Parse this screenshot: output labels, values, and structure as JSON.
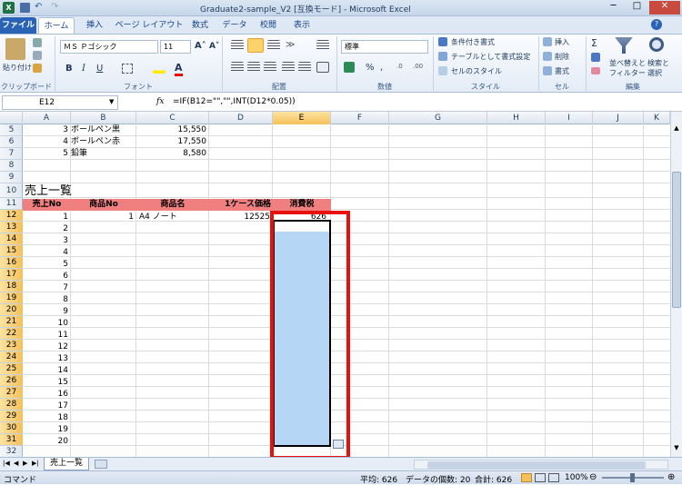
{
  "window": {
    "title": "Graduate2-sample_V2 [互換モード] - Microsoft Excel"
  },
  "tabs": [
    "ファイル",
    "ホーム",
    "挿入",
    "ページ レイアウト",
    "数式",
    "データ",
    "校閲",
    "表示"
  ],
  "ribbon": {
    "clipboard": {
      "paste": "貼り付け",
      "label": "クリップボード"
    },
    "font": {
      "name": "ＭＳ Ｐゴシック",
      "size": "11",
      "label": "フォント"
    },
    "align": {
      "label": "配置"
    },
    "number": {
      "format": "標準",
      "label": "数値"
    },
    "style": {
      "cond": "条件付き書式",
      "table": "テーブルとして書式設定",
      "cell": "セルのスタイル",
      "label": "スタイル"
    },
    "cells": {
      "insert": "挿入",
      "delete": "削除",
      "format": "書式",
      "label": "セル"
    },
    "edit": {
      "sort": "並べ替えと",
      "filter": "フィルター",
      "find": "検索と",
      "select": "選択",
      "label": "編集"
    }
  },
  "formula_bar": {
    "namebox": "E12",
    "fx": "fx",
    "formula": "=IF(B12=\"\",\"\",INT(D12*0.05))"
  },
  "columns": [
    "A",
    "B",
    "C",
    "D",
    "E",
    "F",
    "G",
    "H",
    "I",
    "J",
    "K"
  ],
  "rows": [
    "5",
    "6",
    "7",
    "8",
    "9",
    "10",
    "11",
    "12",
    "13",
    "14",
    "15",
    "16",
    "17",
    "18",
    "19",
    "20",
    "21",
    "22",
    "23",
    "24",
    "25",
    "26",
    "27",
    "28",
    "29",
    "30",
    "31",
    "32"
  ],
  "top_rows": [
    {
      "a": "3",
      "b": "ボールペン黒",
      "c": "15,550"
    },
    {
      "a": "4",
      "b": "ボールペン赤",
      "c": "17,550"
    },
    {
      "a": "5",
      "b": "鉛筆",
      "c": "8,580"
    }
  ],
  "section_title": "売上一覧",
  "table_headers": [
    "売上No",
    "商品No",
    "商品名",
    "1ケース価格",
    "消費税"
  ],
  "first_row": {
    "a": "1",
    "b": "1",
    "c": "A4 ノート",
    "d": "12525",
    "e": "626"
  },
  "sales_numbers": [
    "2",
    "3",
    "4",
    "5",
    "6",
    "7",
    "8",
    "9",
    "10",
    "11",
    "12",
    "13",
    "14",
    "15",
    "16",
    "17",
    "18",
    "19",
    "20"
  ],
  "sheet_tab": "売上一覧",
  "status": {
    "mode": "コマンド",
    "average": "平均: 626",
    "count": "データの個数: 20",
    "sum": "合計: 626",
    "zoom": "100%"
  }
}
